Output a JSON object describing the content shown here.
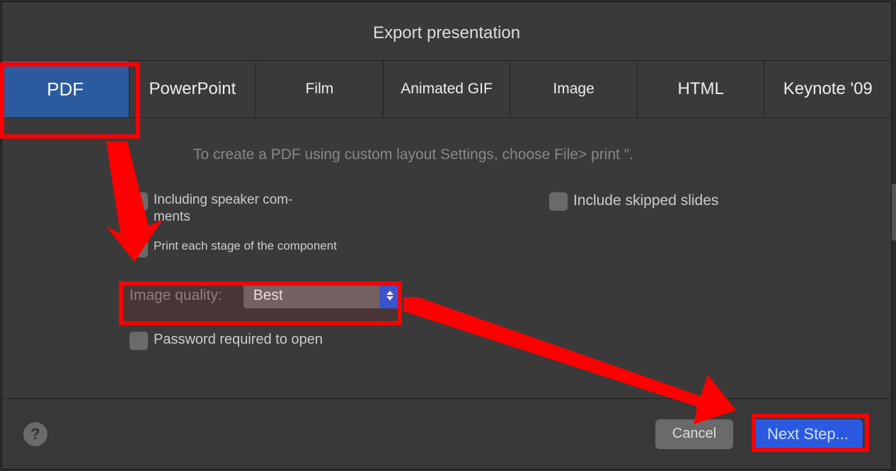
{
  "dialog": {
    "title": "Export presentation",
    "tabs": [
      {
        "label": "PDF",
        "selected": true
      },
      {
        "label": "PowerPoint"
      },
      {
        "label": "Film"
      },
      {
        "label": "Animated GIF"
      },
      {
        "label": "Image"
      },
      {
        "label": "HTML"
      },
      {
        "label": "Keynote '09"
      }
    ],
    "hint": "To create a PDF using custom layout Settings, choose File> print \".",
    "options": {
      "speaker_comments": "Including speaker com-\nments",
      "print_stages": "Print each stage of the component",
      "include_skipped": "Include skipped slides",
      "quality_label": "Image quality:",
      "quality_value": "Best",
      "password": "Password required to open"
    },
    "footer": {
      "help": "?",
      "cancel": "Cancel",
      "next": "Next Step..."
    }
  }
}
